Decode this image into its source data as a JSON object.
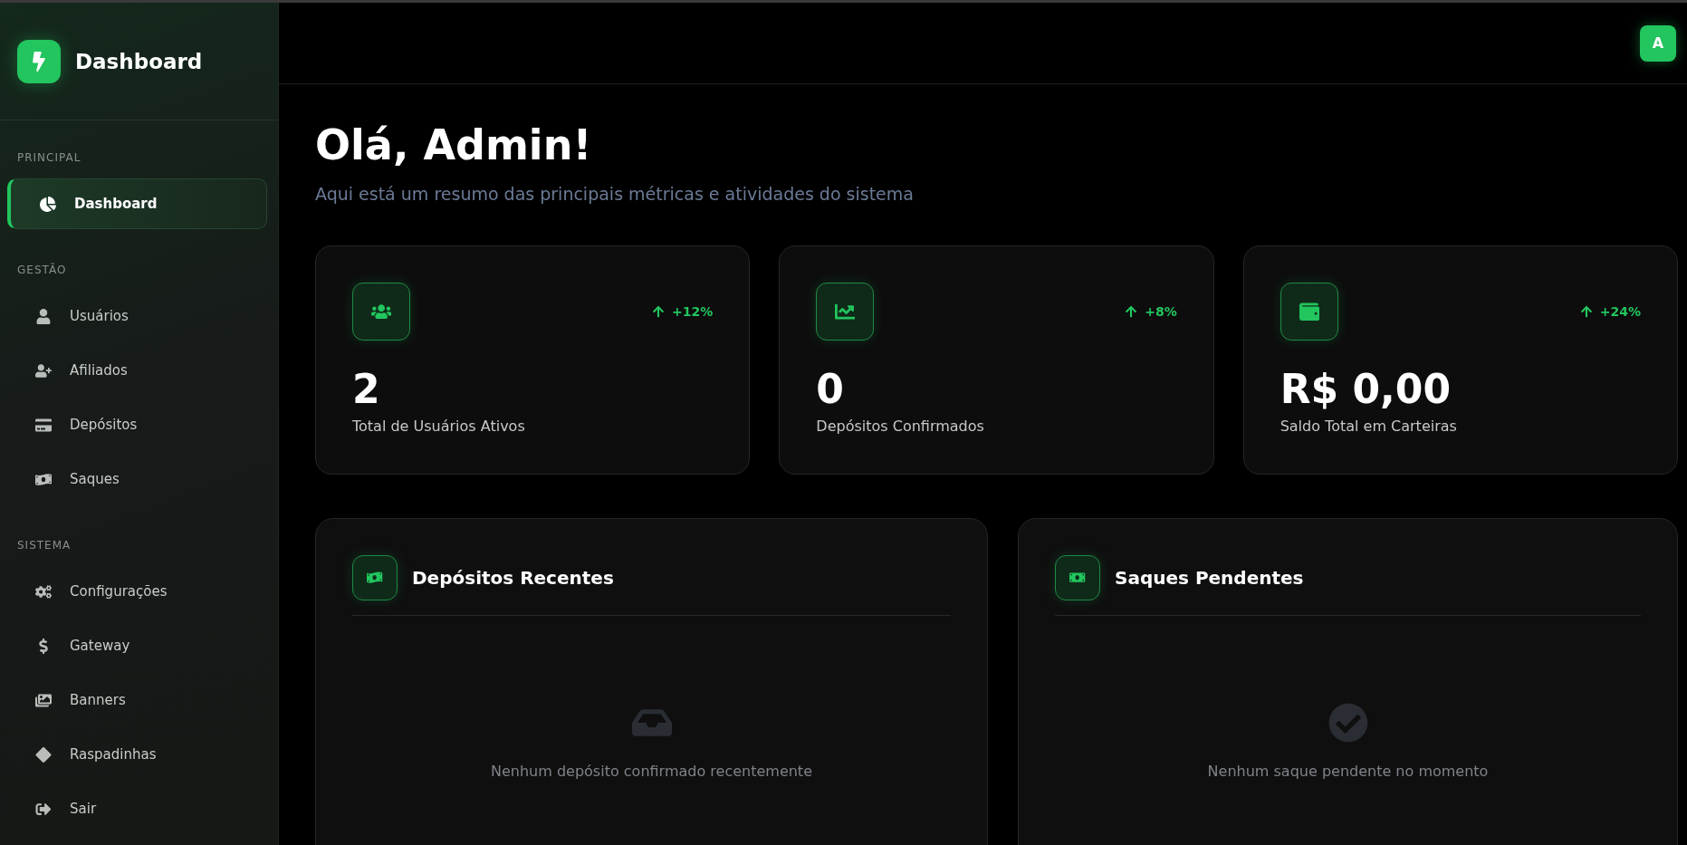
{
  "brand": {
    "title": "Dashboard"
  },
  "sidebar": {
    "sections": [
      {
        "label": "PRINCIPAL",
        "items": [
          {
            "label": "Dashboard",
            "selected": true
          }
        ]
      },
      {
        "label": "GESTÃO",
        "items": [
          {
            "label": "Usuários",
            "selected": false
          },
          {
            "label": "Afiliados",
            "selected": false
          },
          {
            "label": "Depósitos",
            "selected": false
          },
          {
            "label": "Saques",
            "selected": false
          }
        ]
      },
      {
        "label": "SISTEMA",
        "items": [
          {
            "label": "Configurações",
            "selected": false
          },
          {
            "label": "Gateway",
            "selected": false
          },
          {
            "label": "Banners",
            "selected": false
          },
          {
            "label": "Raspadinhas",
            "selected": false
          },
          {
            "label": "Sair",
            "selected": false
          }
        ]
      }
    ]
  },
  "topbar": {
    "avatar": "A"
  },
  "header": {
    "title": "Olá, Admin!",
    "subtitle": "Aqui está um resumo das principais métricas e atividades do sistema"
  },
  "stats": [
    {
      "kind": "users",
      "trend": "+12%",
      "value": "2",
      "label": "Total de Usuários Ativos"
    },
    {
      "kind": "chart",
      "trend": "+8%",
      "value": "0",
      "label": "Depósitos Confirmados"
    },
    {
      "kind": "wallet",
      "trend": "+24%",
      "value": "R$ 0,00",
      "label": "Saldo Total em Carteiras"
    }
  ],
  "panels": [
    {
      "kind": "deposits",
      "title": "Depósitos Recentes",
      "empty": "Nenhum depósito confirmado recentemente"
    },
    {
      "kind": "withdrawals",
      "title": "Saques Pendentes",
      "empty": "Nenhum saque pendente no momento"
    }
  ]
}
